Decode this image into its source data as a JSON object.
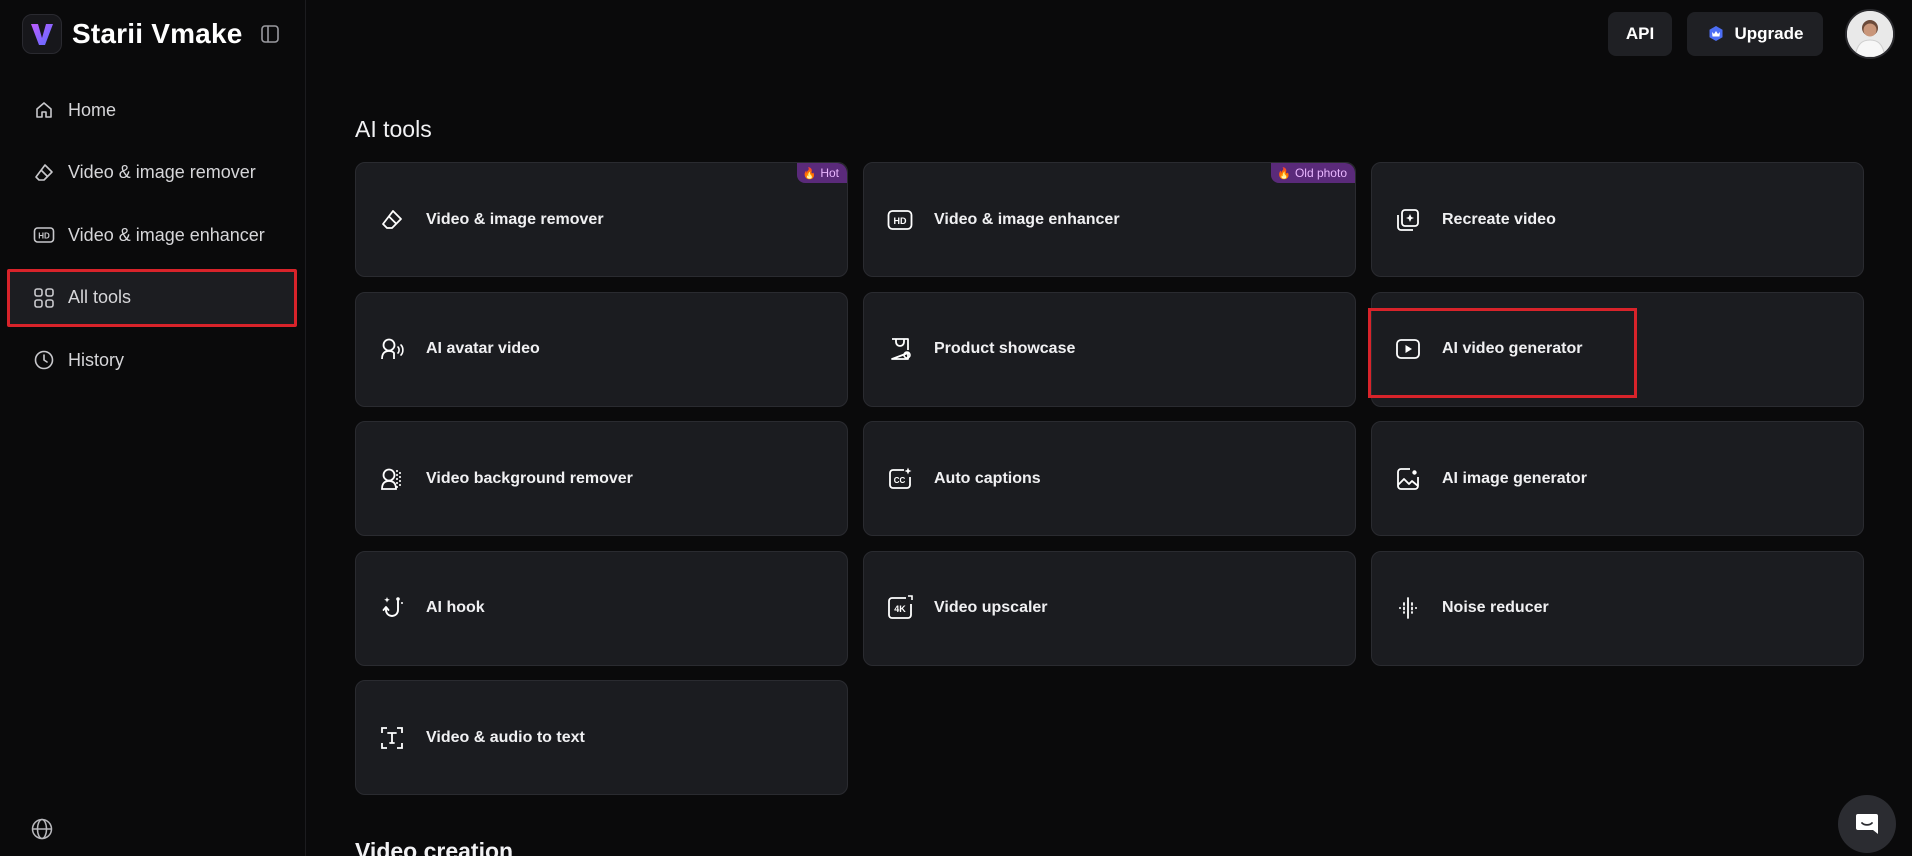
{
  "app": {
    "name": "Starii Vmake"
  },
  "header": {
    "api_label": "API",
    "upgrade_label": "Upgrade"
  },
  "sidebar": {
    "items": [
      {
        "label": "Home",
        "icon": "home-icon"
      },
      {
        "label": "Video & image remover",
        "icon": "eraser-icon"
      },
      {
        "label": "Video & image enhancer",
        "icon": "hd-icon"
      },
      {
        "label": "All tools",
        "icon": "grid-icon",
        "active": true
      },
      {
        "label": "History",
        "icon": "clock-icon"
      }
    ]
  },
  "main": {
    "section_title": "AI tools",
    "next_section_title": "Video creation",
    "tools": [
      {
        "label": "Video & image remover",
        "icon": "eraser-icon",
        "badge": "Hot"
      },
      {
        "label": "Video & image enhancer",
        "icon": "hd-icon",
        "badge": "Old photo"
      },
      {
        "label": "Recreate video",
        "icon": "recreate-icon"
      },
      {
        "label": "AI avatar video",
        "icon": "avatar-speak-icon"
      },
      {
        "label": "Product showcase",
        "icon": "product-bag-icon"
      },
      {
        "label": "AI video generator",
        "icon": "play-icon",
        "highlighted": true
      },
      {
        "label": "Video background remover",
        "icon": "person-cutout-icon"
      },
      {
        "label": "Auto captions",
        "icon": "cc-icon"
      },
      {
        "label": "AI image generator",
        "icon": "image-icon"
      },
      {
        "label": "AI hook",
        "icon": "hook-icon"
      },
      {
        "label": "Video upscaler",
        "icon": "4k-icon"
      },
      {
        "label": "Noise reducer",
        "icon": "waveform-icon"
      },
      {
        "label": "Video & audio to text",
        "icon": "text-scan-icon"
      }
    ]
  },
  "colors": {
    "background": "#0a0a0b",
    "card": "#1b1c20",
    "highlight": "#d8232a",
    "badge_bg": "#5a2a7a",
    "badge_text": "#e9b6ff",
    "upgrade_crown": "#4c6ef5"
  }
}
